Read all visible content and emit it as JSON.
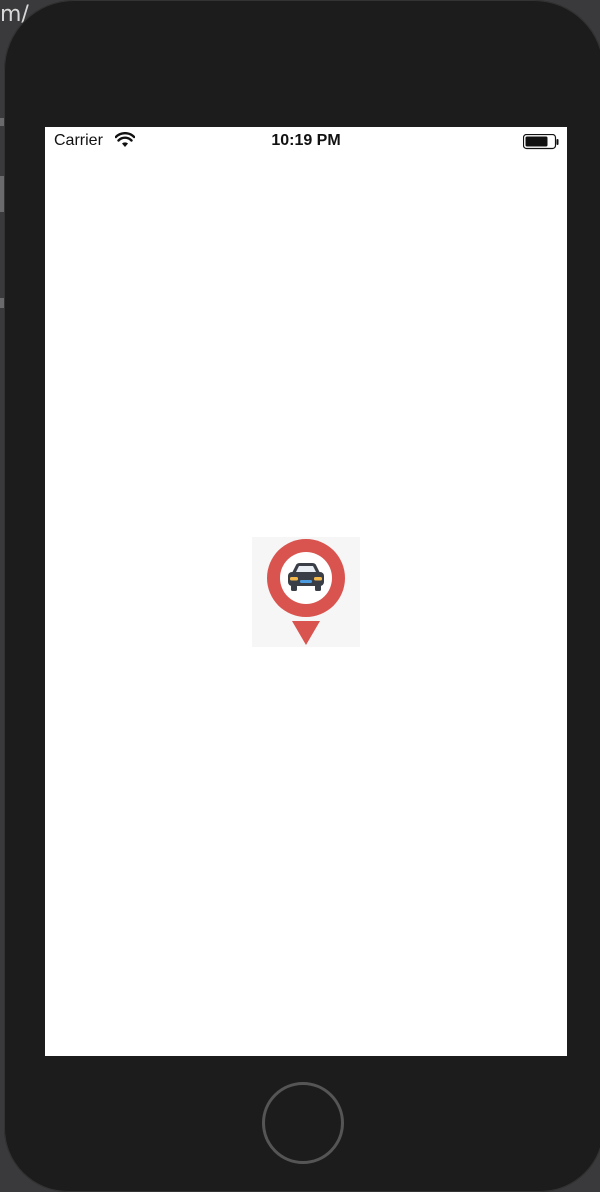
{
  "background_app": {
    "partial_text": "m/"
  },
  "status_bar": {
    "carrier": "Carrier",
    "time": "10:19 PM"
  },
  "splash": {
    "logo_icon": "car-location-pin-icon",
    "pin_color": "#d9534f",
    "car_color": "#3a3f47",
    "headlight_color": "#f5b84b",
    "grille_color": "#4a9be0"
  },
  "device": {
    "home_button_icon": "home-button"
  }
}
